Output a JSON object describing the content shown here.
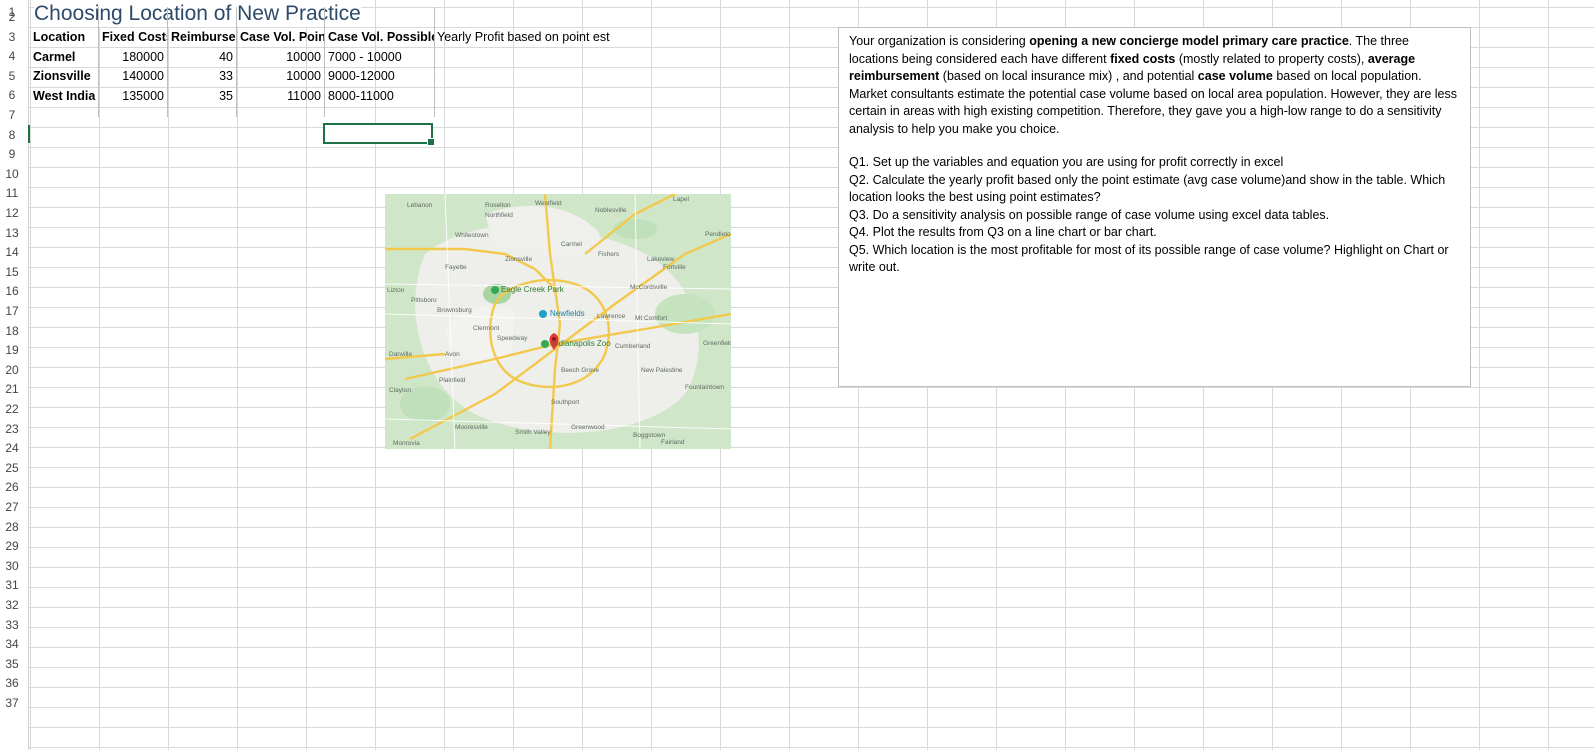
{
  "title": "Choosing Location of New Practice",
  "row_numbers": [
    "1",
    "2",
    "3",
    "4",
    "5",
    "6",
    "7",
    "8",
    "9",
    "10",
    "11",
    "12",
    "13",
    "14",
    "15",
    "16",
    "17",
    "18",
    "19",
    "20",
    "21",
    "22",
    "23",
    "24",
    "25",
    "26",
    "27",
    "28",
    "29",
    "30",
    "31",
    "32",
    "33",
    "34",
    "35",
    "36",
    "37"
  ],
  "table": {
    "headers": [
      "Location",
      "Fixed Costs",
      "Reimburse",
      "Case Vol. Poin",
      "Case Vol. Possible",
      "Yearly Profit based on point est"
    ],
    "rows": [
      [
        "Carmel",
        "180000",
        "40",
        "10000",
        "7000 - 10000"
      ],
      [
        "Zionsville",
        "140000",
        "33",
        "10000",
        "9000-12000"
      ],
      [
        "West India",
        "135000",
        "35",
        "11000",
        "8000-11000"
      ]
    ]
  },
  "textbox": {
    "intro_1": "Your organization is considering ",
    "intro_b1": "opening a new concierge model primary care practice",
    "intro_2": ".  The three locations being considered each have different ",
    "intro_b2": "fixed costs",
    "intro_3": " (mostly related to property costs), ",
    "intro_b3": "average reimbursement",
    "intro_4": " (based on local insurance mix) , and potential ",
    "intro_b4": "case volume",
    "intro_5": " based on local population.  Market consultants estimate the potential case volume based on local area population.   However, they are less certain in areas with high existing competition.  Therefore, they gave you a high-low range to do a sensitivity analysis to help you make you choice.",
    "q1": "Q1. Set up the variables and equation you are using for profit correctly in excel",
    "q2": "Q2. Calculate the yearly profit based only the point estimate (avg case volume)and show in the table.  Which location looks the best using point estimates?",
    "q3": "Q3. Do a sensitivity analysis on possible range of case volume using excel data tables.",
    "q4": "Q4. Plot the results from Q3 on a line chart or bar chart.",
    "q5": "Q5. Which location is the most profitable for most of its possible range of case volume? Highlight on Chart or write out."
  },
  "map": {
    "labels": [
      "Lebanon",
      "Westfield",
      "Noblesville",
      "Lapel",
      "Roselton",
      "Northfield",
      "Whitestown",
      "Carmel",
      "Fishers",
      "Pendleton",
      "Zionsville",
      "Lawrence",
      "McCordsville",
      "Fayette",
      "Lizton",
      "Pittsboro",
      "Brownsburg",
      "Mt Comfort",
      "Clermont",
      "Speedway",
      "Cumberland",
      "Greenfield",
      "Danville",
      "Avon",
      "New Palestine",
      "Plainfield",
      "Beech Grove",
      "Fountaintown",
      "Clayton",
      "Southport",
      "Mooresville",
      "Greenwood",
      "Smith Valley",
      "Boggstown",
      "Monrovia",
      "Fairland",
      "Lakeview",
      "Fortville"
    ],
    "poi": [
      "Eagle Creek Park",
      "Newfields",
      "Indianapolis Zoo"
    ],
    "colors": {
      "land": "#e8efe6",
      "green": "#b7dcb5",
      "urban": "#f1f1ee",
      "highway": "#f2c94c",
      "pin": "#e53935"
    }
  },
  "colors": {
    "grid": "#d9d9d9",
    "title": "#2e4a6b",
    "selection": "#1e7145"
  }
}
